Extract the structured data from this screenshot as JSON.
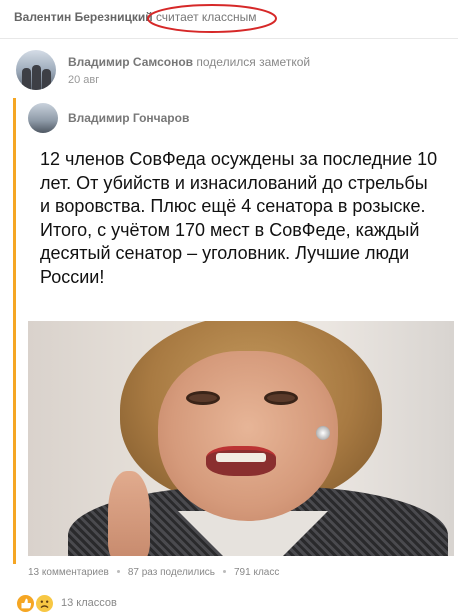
{
  "activity": {
    "actor": "Валентин Березницкий",
    "action": "считает классным"
  },
  "note": {
    "author": "Владимир Самсонов",
    "verb": "поделился заметкой",
    "date": "20 авг"
  },
  "shared": {
    "author": "Владимир Гончаров",
    "text": "12 членов СовФеда осуждены за последние 10 лет. От убийств и изнасилований до стрельбы и воровства. Плюс ещё 4 сенатора в розыске. Итого, с учётом 170 мест в СовФеде, каждый десятый сенатор – уголовник. Лучшие люди России!"
  },
  "stats": {
    "comments": "13 комментариев",
    "shares": "87 раз поделились",
    "classes": "791 класс"
  },
  "reactions": {
    "count_label": "13 классов"
  },
  "colors": {
    "accent": "#f5a623",
    "circle_mark": "#d62828"
  }
}
